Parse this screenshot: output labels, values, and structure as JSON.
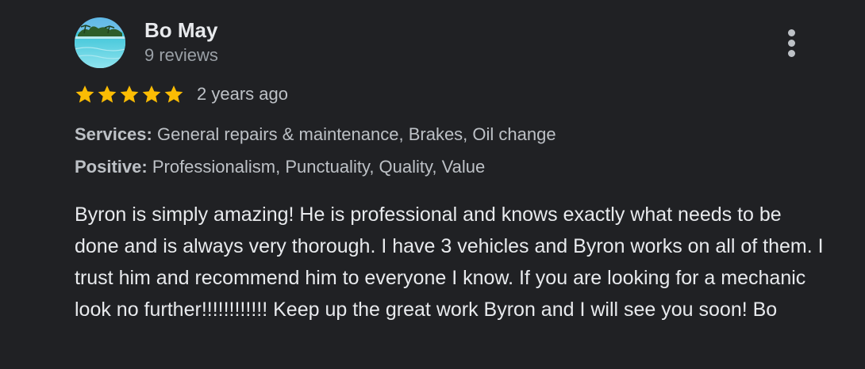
{
  "author": {
    "name": "Bo May",
    "reviews_count": "9 reviews",
    "avatar_icon": "beach-island-avatar"
  },
  "rating": {
    "stars": 5,
    "max_stars": 5,
    "star_color": "#fbbc04",
    "date": "2 years ago"
  },
  "attributes": {
    "services_label": "Services:",
    "services_value": "General repairs & maintenance, Brakes, Oil change",
    "positive_label": "Positive:",
    "positive_value": "Professionalism, Punctuality, Quality, Value"
  },
  "review_text": "Byron is simply amazing! He is professional and knows exactly what needs to be done and is always very thorough. I have 3 vehicles and Byron works on all of them. I trust him and recommend him to everyone I know. If you are looking for a mechanic look no further!!!!!!!!!!!! Keep up the great work Byron and I will see you soon! Bo",
  "actions": {
    "more_icon": "more-vertical-icon"
  },
  "colors": {
    "background": "#202124",
    "primary_text": "#e8eaed",
    "secondary_text": "#9aa0a6",
    "accent_star": "#fbbc04"
  }
}
